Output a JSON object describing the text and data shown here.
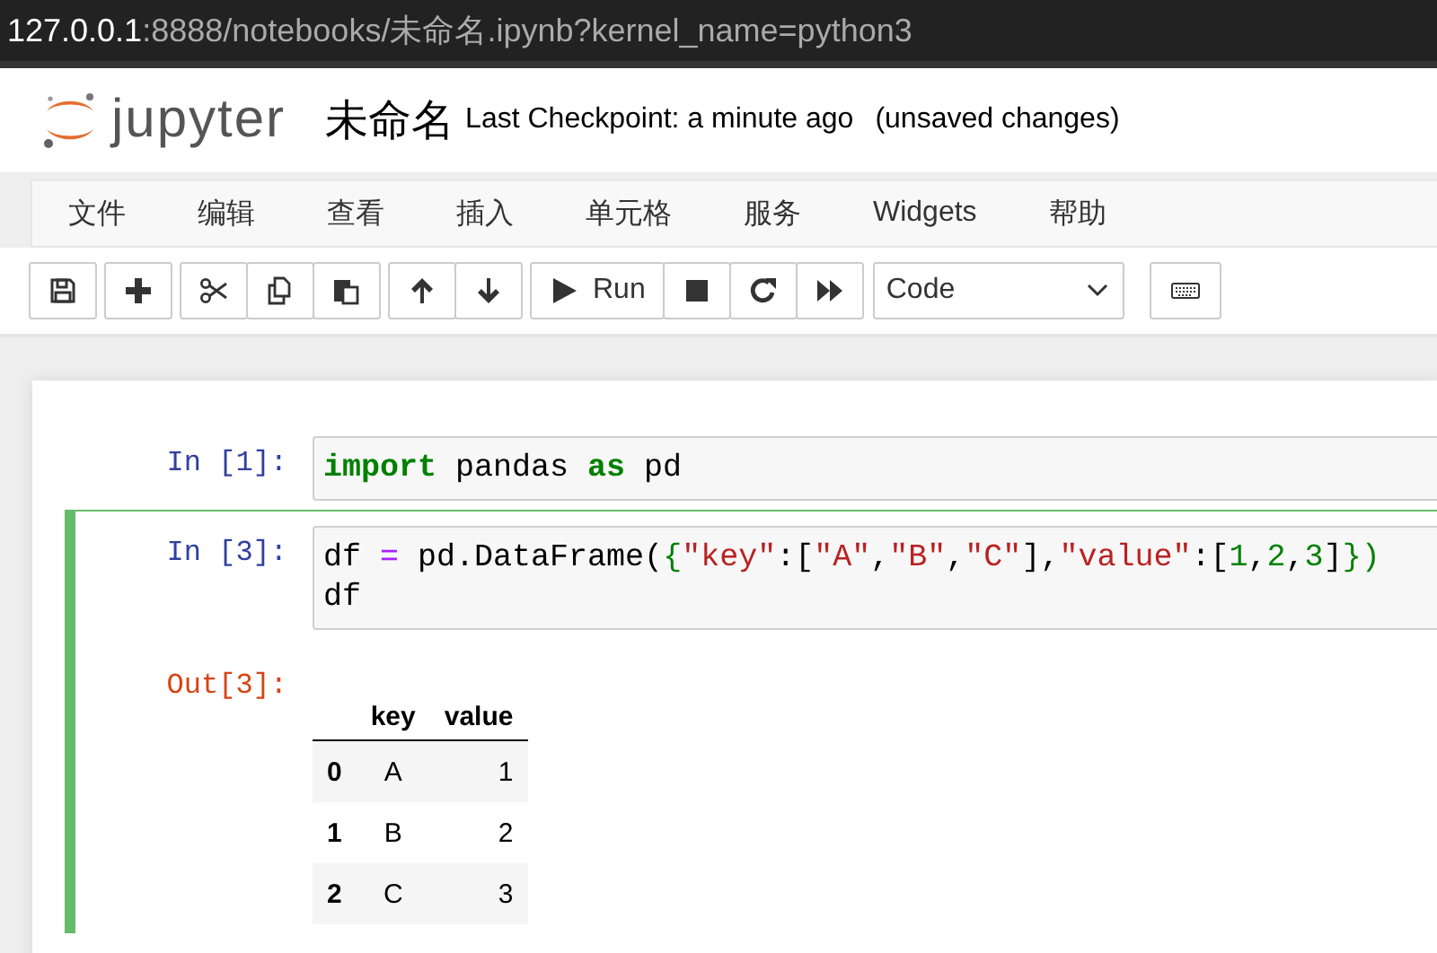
{
  "address": {
    "host": "127.0.0.1",
    "path": ":8888/notebooks/未命名.ipynb?kernel_name=python3"
  },
  "header": {
    "logo": "jupyter",
    "title": "未命名",
    "checkpoint": "Last Checkpoint: a minute ago",
    "status": "(unsaved changes)"
  },
  "menu": [
    "文件",
    "编辑",
    "查看",
    "插入",
    "单元格",
    "服务",
    "Widgets",
    "帮助"
  ],
  "toolbar": {
    "groups": [
      [
        {
          "kind": "save"
        }
      ],
      [
        {
          "kind": "plus"
        }
      ],
      [
        {
          "kind": "cut"
        },
        {
          "kind": "copy"
        },
        {
          "kind": "paste"
        }
      ],
      [
        {
          "kind": "up"
        },
        {
          "kind": "down"
        }
      ],
      [
        {
          "kind": "run",
          "label": "Run"
        },
        {
          "kind": "stop"
        },
        {
          "kind": "restart"
        },
        {
          "kind": "fastforward"
        }
      ]
    ],
    "cell_type": "Code",
    "after": [
      [
        {
          "kind": "keyboard"
        }
      ]
    ]
  },
  "cells": [
    {
      "prompt": "In [1]:",
      "selected": false,
      "lines": [
        [
          {
            "text": "import",
            "kind": "keyword"
          },
          {
            "text": " pandas ",
            "kind": "plain"
          },
          {
            "text": "as",
            "kind": "keyword"
          },
          {
            "text": " pd",
            "kind": "plain"
          }
        ]
      ]
    },
    {
      "prompt": "In [3]:",
      "selected": true,
      "lines": [
        [
          {
            "text": "df ",
            "kind": "plain"
          },
          {
            "text": "=",
            "kind": "op"
          },
          {
            "text": " pd.DataFrame(",
            "kind": "plain"
          },
          {
            "text": "{",
            "kind": "brace"
          },
          {
            "text": "\"key\"",
            "kind": "string"
          },
          {
            "text": ":[",
            "kind": "plain"
          },
          {
            "text": "\"A\"",
            "kind": "string"
          },
          {
            "text": ",",
            "kind": "plain"
          },
          {
            "text": "\"B\"",
            "kind": "string"
          },
          {
            "text": ",",
            "kind": "plain"
          },
          {
            "text": "\"C\"",
            "kind": "string"
          },
          {
            "text": "],",
            "kind": "plain"
          },
          {
            "text": "\"value\"",
            "kind": "string"
          },
          {
            "text": ":[",
            "kind": "plain"
          },
          {
            "text": "1",
            "kind": "number"
          },
          {
            "text": ",",
            "kind": "plain"
          },
          {
            "text": "2",
            "kind": "number"
          },
          {
            "text": ",",
            "kind": "plain"
          },
          {
            "text": "3",
            "kind": "number"
          },
          {
            "text": "]",
            "kind": "plain"
          },
          {
            "text": "})",
            "kind": "brace"
          }
        ],
        [
          {
            "text": "df",
            "kind": "plain"
          }
        ]
      ],
      "output": {
        "prompt": "Out[3]:",
        "columns": [
          "key",
          "value"
        ],
        "rows": [
          {
            "index": "0",
            "cells": [
              "A",
              "1"
            ]
          },
          {
            "index": "1",
            "cells": [
              "B",
              "2"
            ]
          },
          {
            "index": "2",
            "cells": [
              "C",
              "3"
            ]
          }
        ]
      }
    }
  ]
}
